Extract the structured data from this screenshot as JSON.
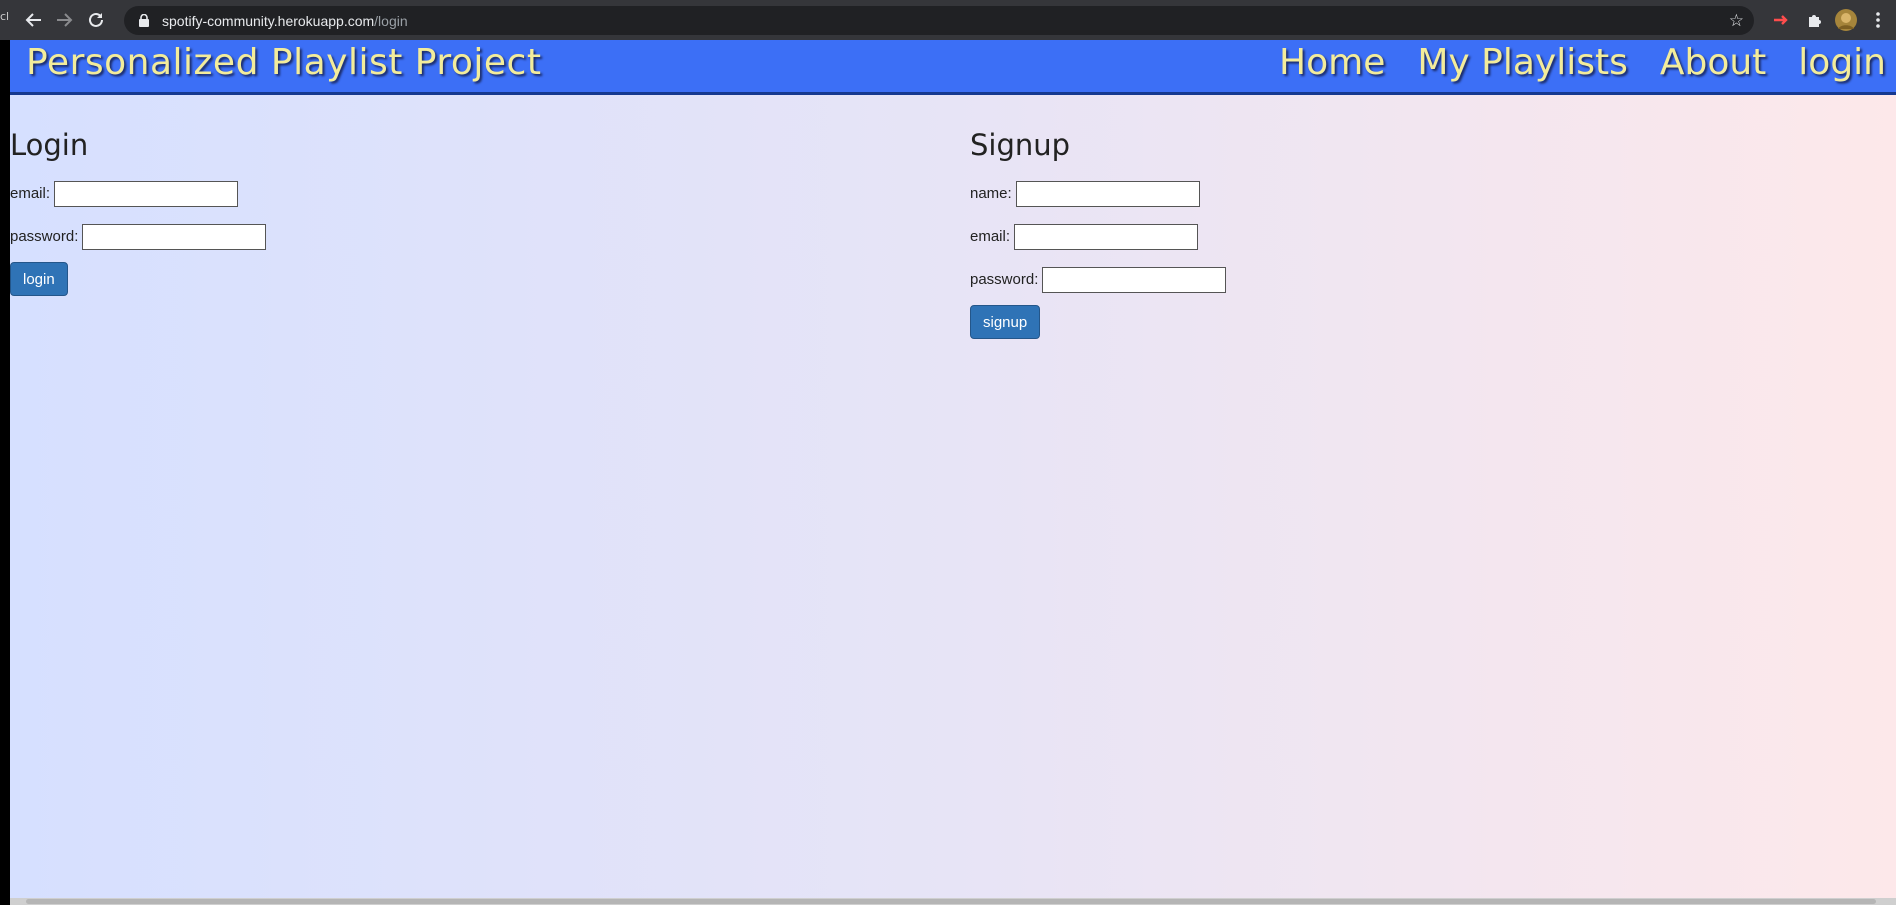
{
  "browser": {
    "url_host": "spotify-community.herokuapp.com",
    "url_path": "/login",
    "left_strip_chars": "cl"
  },
  "site": {
    "brand": "Personalized Playlist Project",
    "nav": [
      {
        "label": "Home"
      },
      {
        "label": "My Playlists"
      },
      {
        "label": "About"
      },
      {
        "label": "login"
      }
    ]
  },
  "login": {
    "title": "Login",
    "email_label": "email:",
    "password_label": "password:",
    "button_label": "login"
  },
  "signup": {
    "title": "Signup",
    "name_label": "name:",
    "email_label": "email:",
    "password_label": "password:",
    "button_label": "signup"
  },
  "colors": {
    "navbar": "#3c6ff6",
    "nav_text": "#f3ec9b",
    "button": "#2f73b6"
  },
  "icons": [
    "back-arrow-icon",
    "forward-arrow-icon",
    "reload-icon",
    "lock-icon",
    "star-icon",
    "extension-icon",
    "puzzle-icon",
    "profile-avatar",
    "kebab-menu-icon"
  ]
}
